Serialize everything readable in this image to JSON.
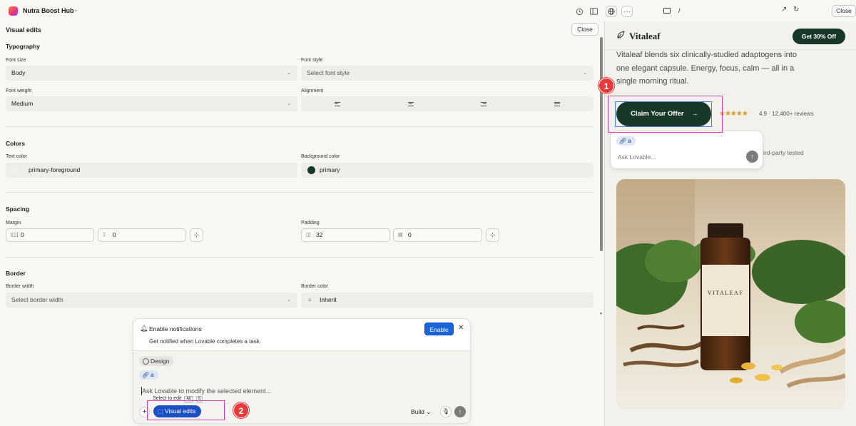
{
  "topbar": {
    "project_name": "Nutra Boost Hub",
    "url_path": "/",
    "close_label": "Close"
  },
  "panel": {
    "title": "Visual edits",
    "close_label": "Close",
    "typography": {
      "title": "Typography",
      "font_size_label": "Font size",
      "font_size_value": "Body",
      "font_style_label": "Font style",
      "font_style_placeholder": "Select font style",
      "font_weight_label": "Font weight",
      "font_weight_value": "Medium",
      "alignment_label": "Alignment",
      "alignment_options": [
        "left",
        "center",
        "right",
        "justify"
      ]
    },
    "colors": {
      "title": "Colors",
      "text_color_label": "Text color",
      "text_color_value": "primary-foreground",
      "background_color_label": "Background color",
      "background_color_value": "primary",
      "background_swatch": "#173828"
    },
    "spacing": {
      "title": "Spacing",
      "margin_label": "Margin",
      "margin_x": "0",
      "margin_y": "0",
      "padding_label": "Padding",
      "padding_x": "32",
      "padding_y": "0"
    },
    "border": {
      "title": "Border",
      "border_width_label": "Border width",
      "border_width_placeholder": "Select border width",
      "border_color_label": "Border color",
      "border_color_value": "Inherit"
    }
  },
  "chat": {
    "notification_title": "Enable notifications",
    "notification_sub": "Get notified when Lovable completes a task.",
    "enable_label": "Enable",
    "design_chip": "Design",
    "element_chip": "a",
    "input_placeholder": "Ask Lovable to modify the selected element...",
    "tooltip_text": "Select to edit",
    "tooltip_keys": [
      "Alt",
      "S"
    ],
    "visual_edits_label": "Visual edits",
    "build_label": "Build"
  },
  "annotations": {
    "badge_1": "1",
    "badge_2": "2",
    "highlight_color": "#d63bb0",
    "badge_color": "#e8393a"
  },
  "preview": {
    "brand": "Vitaleaf",
    "header_cta": "Get 30% Off",
    "body_text": "Vitaleaf blends six clinically-studied adaptogens into one elegant capsule. Energy, focus, calm — all in a single morning ritual.",
    "claim_button": "Claim Your Offer",
    "stars": "★★★★★",
    "rating_text": "4.9 · 12,400+ reviews",
    "tested_text": "ird-party tested",
    "popover_chip": "a",
    "popover_placeholder": "Ask Lovable...",
    "bottle_label": "VITALEAF",
    "brand_color": "#173828"
  }
}
